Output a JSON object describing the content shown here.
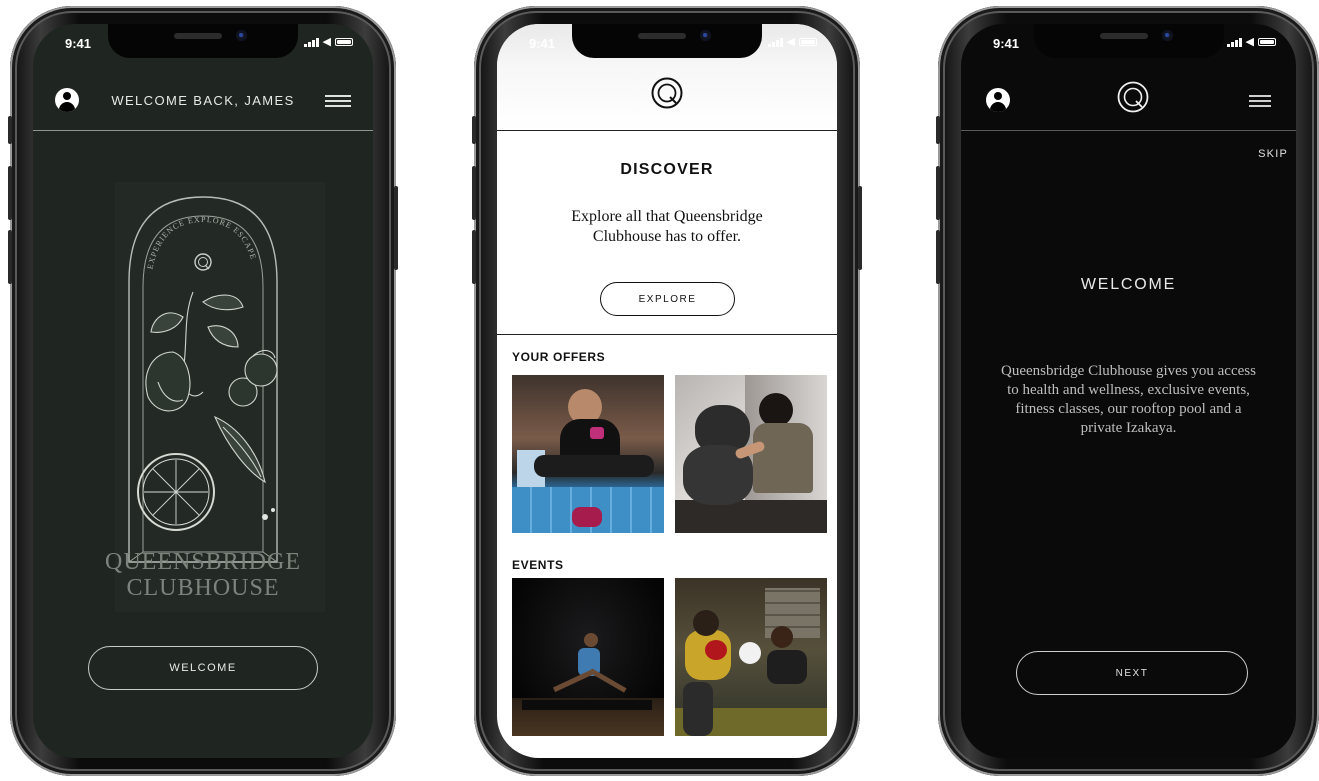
{
  "colors": {
    "green_bg": "#1f2621",
    "black_bg": "#0a0a0a",
    "white_bg": "#ffffff",
    "line": "#8e958f"
  },
  "status": {
    "time": "9:41"
  },
  "phone1": {
    "header_title": "WELCOME BACK, JAMES",
    "arch_text": "EXPERIENCE EXPLORE ESCAPE",
    "brand_line1": "QUEENSBRIDGE",
    "brand_line2": "CLUBHOUSE",
    "cta_label": "WELCOME"
  },
  "phone2": {
    "section_title": "DISCOVER",
    "description": "Explore all that Queensbridge Clubhouse has to offer.",
    "cta_label": "EXPLORE",
    "offers_label": "YOUR OFFERS",
    "events_label": "EVENTS"
  },
  "phone3": {
    "skip_label": "SKIP",
    "title": "WELCOME",
    "description": "Queensbridge Clubhouse gives you access to health and wellness, exclusive events, fitness classes, our rooftop pool and a private Izakaya.",
    "cta_label": "NEXT"
  },
  "icons": [
    "user-icon",
    "menu-icon",
    "logo-q-icon",
    "signal-icon",
    "wifi-icon",
    "battery-icon"
  ]
}
